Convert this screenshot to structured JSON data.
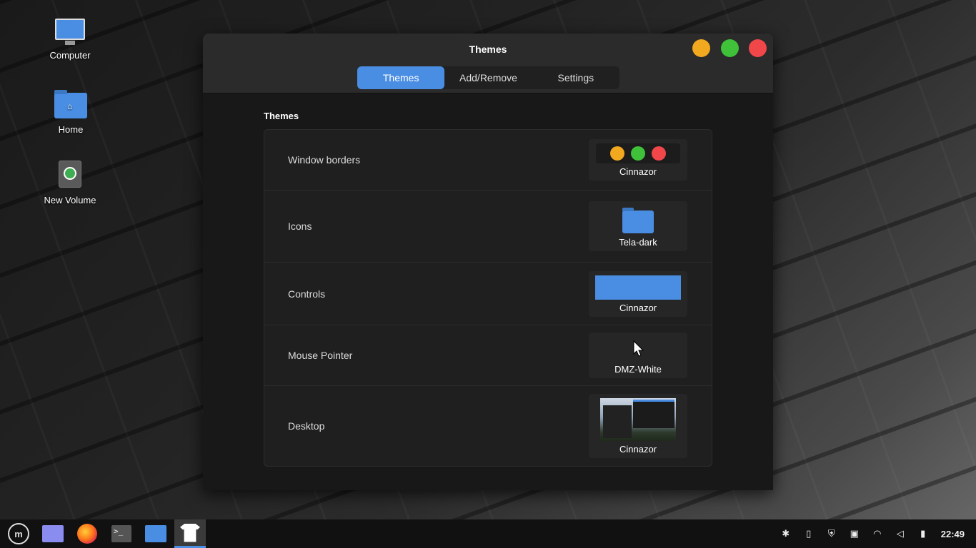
{
  "desktop": {
    "icons": [
      {
        "label": "Computer"
      },
      {
        "label": "Home"
      },
      {
        "label": "New Volume"
      }
    ]
  },
  "window": {
    "title": "Themes",
    "tabs": [
      {
        "label": "Themes",
        "active": true
      },
      {
        "label": "Add/Remove",
        "active": false
      },
      {
        "label": "Settings",
        "active": false
      }
    ],
    "section_title": "Themes",
    "rows": [
      {
        "label": "Window borders",
        "value": "Cinnazor",
        "preview": "window-buttons"
      },
      {
        "label": "Icons",
        "value": "Tela-dark",
        "preview": "folder-icon"
      },
      {
        "label": "Controls",
        "value": "Cinnazor",
        "preview": "color-swatch"
      },
      {
        "label": "Mouse Pointer",
        "value": "DMZ-White",
        "preview": "pointer-icon"
      },
      {
        "label": "Desktop",
        "value": "Cinnazor",
        "preview": "desktop-screenshot"
      }
    ]
  },
  "taskbar": {
    "clock": "22:49",
    "launchers": [
      "menu-icon",
      "files-icon",
      "firefox-icon",
      "terminal-icon",
      "folder-icon",
      "themes-icon"
    ],
    "tray": [
      "bluetooth-icon",
      "clipboard-icon",
      "shield-icon",
      "keyboard-icon",
      "wifi-icon",
      "volume-icon",
      "battery-icon"
    ]
  },
  "colors": {
    "accent": "#4a8ee4",
    "minimize": "#f2a91f",
    "maximize": "#3fc23a",
    "close": "#f2474a"
  }
}
